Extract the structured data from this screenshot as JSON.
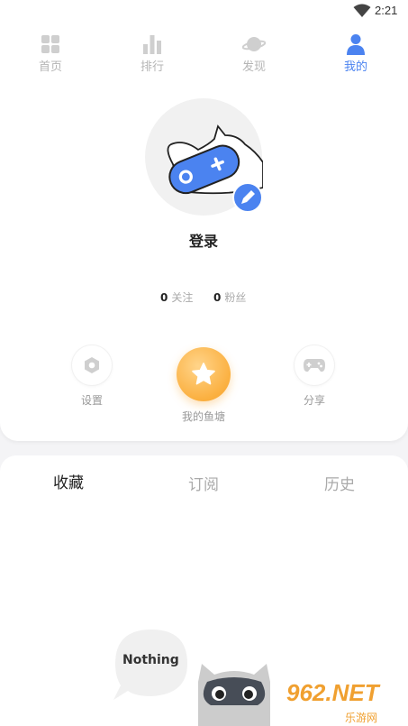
{
  "status_bar": {
    "time": "2:21"
  },
  "nav": {
    "tabs": [
      {
        "label": "首页",
        "icon": "grid-icon",
        "active": false
      },
      {
        "label": "排行",
        "icon": "bar-chart-icon",
        "active": false
      },
      {
        "label": "发现",
        "icon": "planet-icon",
        "active": false
      },
      {
        "label": "我的",
        "icon": "user-icon",
        "active": true
      }
    ]
  },
  "profile": {
    "avatar_icon": "gamepad-cat-avatar",
    "edit_icon": "pencil-icon",
    "login_label": "登录",
    "following_count": "0",
    "following_label": "关注",
    "fans_count": "0",
    "fans_label": "粉丝"
  },
  "actions": {
    "settings_label": "设置",
    "fishwall_label": "我的鱼塘",
    "share_label": "分享"
  },
  "library": {
    "tabs": [
      {
        "label": "收藏",
        "active": true
      },
      {
        "label": "订阅",
        "active": false
      },
      {
        "label": "历史",
        "active": false
      }
    ],
    "empty_bubble_text": "Nothing"
  },
  "watermark": {
    "text": "962.NET",
    "subtext": "乐游网"
  },
  "colors": {
    "accent_blue": "#4b83f0",
    "orange": "#fbb040",
    "inactive_gray": "#b5b5b5",
    "background": "#f4f4f6"
  }
}
